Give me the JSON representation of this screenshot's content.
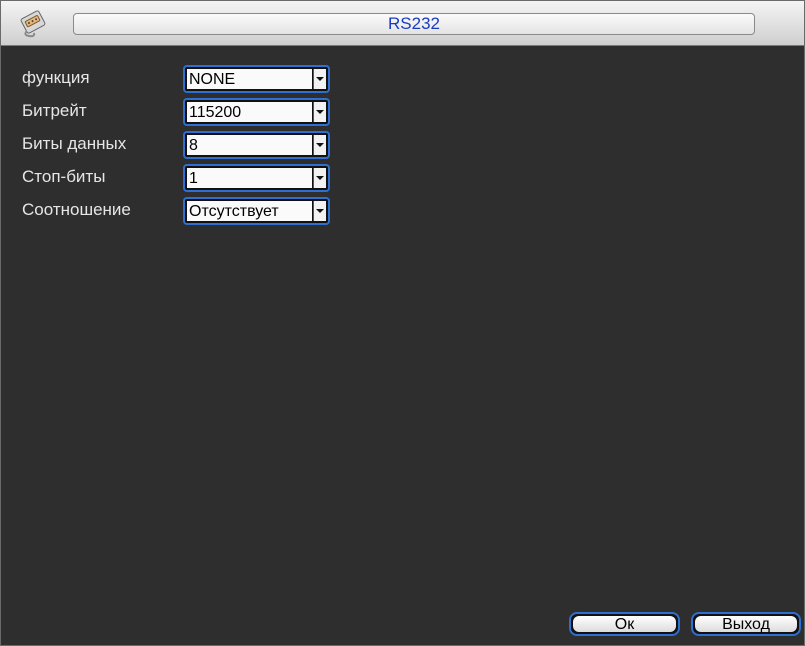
{
  "window": {
    "title": "RS232",
    "icon": "serial-port-icon"
  },
  "form": {
    "rows": [
      {
        "label": "функция",
        "value": "NONE"
      },
      {
        "label": "Битрейт",
        "value": "115200"
      },
      {
        "label": "Биты данных",
        "value": "8"
      },
      {
        "label": "Стоп-биты",
        "value": "1"
      },
      {
        "label": "Соотношение",
        "value": "Отсутствует"
      }
    ]
  },
  "buttons": {
    "ok_label": "Ок",
    "exit_label": "Выход"
  },
  "colors": {
    "accent": "#2f6fd0",
    "title_text": "#1a3bc0",
    "background": "#2e2e2e"
  }
}
